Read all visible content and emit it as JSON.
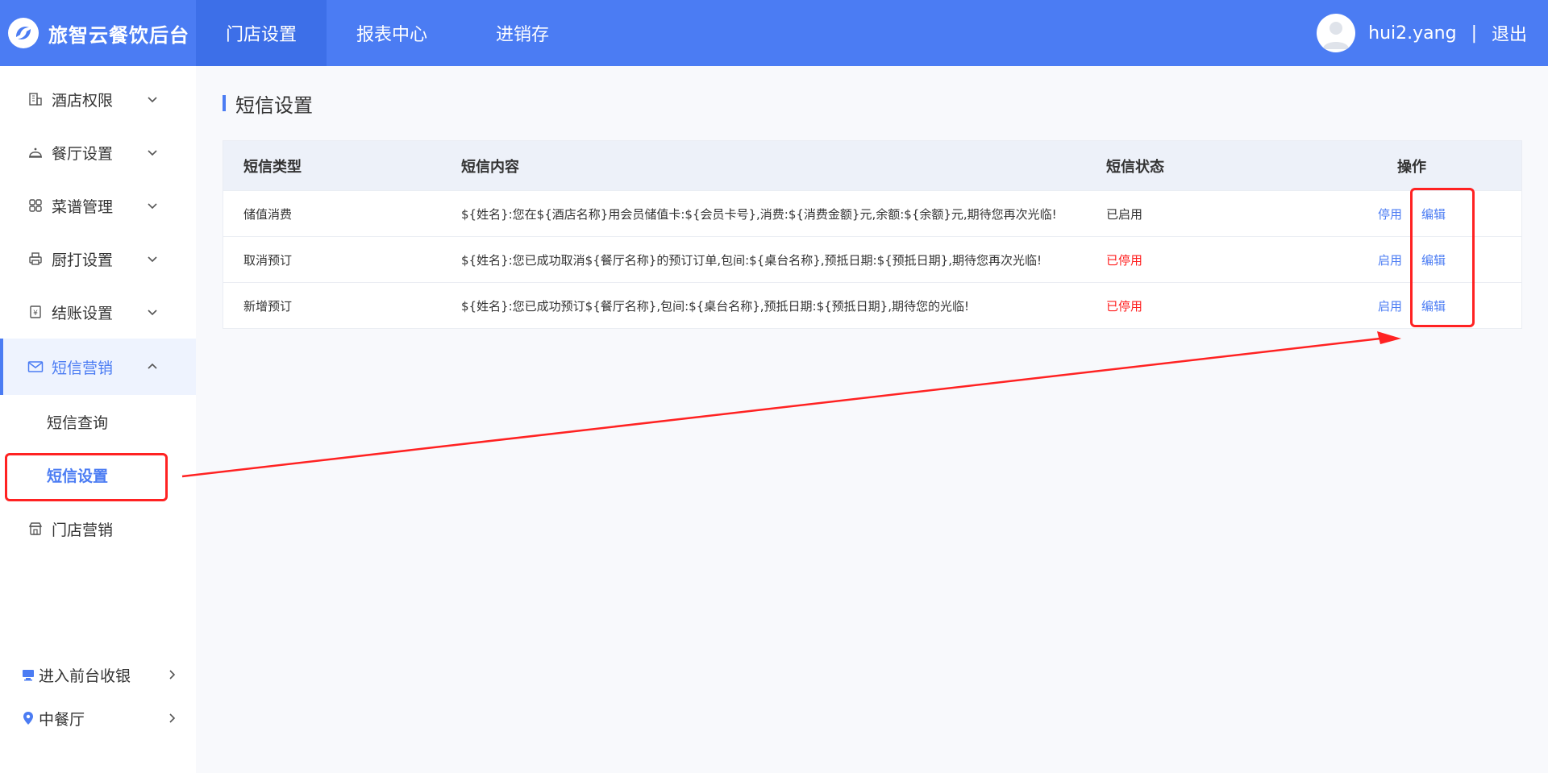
{
  "app": {
    "brand_name": "旅智云餐饮后台",
    "accent_color": "#4b7cf3",
    "highlight_color": "#ff2222"
  },
  "topnav": {
    "items": [
      {
        "label": "门店设置",
        "active": true
      },
      {
        "label": "报表中心",
        "active": false
      },
      {
        "label": "进销存",
        "active": false
      }
    ]
  },
  "user": {
    "name": "hui2.yang",
    "separator": "|",
    "logout": "退出"
  },
  "sidebar": {
    "items": [
      {
        "label": "酒店权限",
        "icon": "hotel-icon"
      },
      {
        "label": "餐厅设置",
        "icon": "cloche-icon"
      },
      {
        "label": "菜谱管理",
        "icon": "grid-icon"
      },
      {
        "label": "厨打设置",
        "icon": "printer-icon"
      },
      {
        "label": "结账设置",
        "icon": "receipt-icon"
      },
      {
        "label": "短信营销",
        "icon": "mail-icon",
        "open": true
      }
    ],
    "sub_items": [
      {
        "label": "短信查询",
        "active": false
      },
      {
        "label": "短信设置",
        "active": true
      }
    ],
    "after_items": [
      {
        "label": "门店营销",
        "icon": "store-icon"
      }
    ],
    "bottom": [
      {
        "label": "进入前台收银",
        "icon": "monitor-icon"
      },
      {
        "label": "中餐厅",
        "icon": "location-pin-icon"
      }
    ]
  },
  "main": {
    "title": "短信设置",
    "table": {
      "headers": {
        "type": "短信类型",
        "content": "短信内容",
        "status": "短信状态",
        "ops": "操作"
      },
      "rows": [
        {
          "type": "储值消费",
          "content": "${姓名}:您在${酒店名称}用会员储值卡:${会员卡号},消费:${消费金额}元,余额:${余额}元,期待您再次光临!",
          "status": "已启用",
          "status_enabled": true,
          "toggle": "停用",
          "edit": "编辑"
        },
        {
          "type": "取消预订",
          "content": "${姓名}:您已成功取消${餐厅名称}的预订订单,包间:${桌台名称},预抵日期:${预抵日期},期待您再次光临!",
          "status": "已停用",
          "status_enabled": false,
          "toggle": "启用",
          "edit": "编辑"
        },
        {
          "type": "新增预订",
          "content": "${姓名}:您已成功预订${餐厅名称},包间:${桌台名称},预抵日期:${预抵日期},期待您的光临!",
          "status": "已停用",
          "status_enabled": false,
          "toggle": "启用",
          "edit": "编辑"
        }
      ]
    }
  }
}
